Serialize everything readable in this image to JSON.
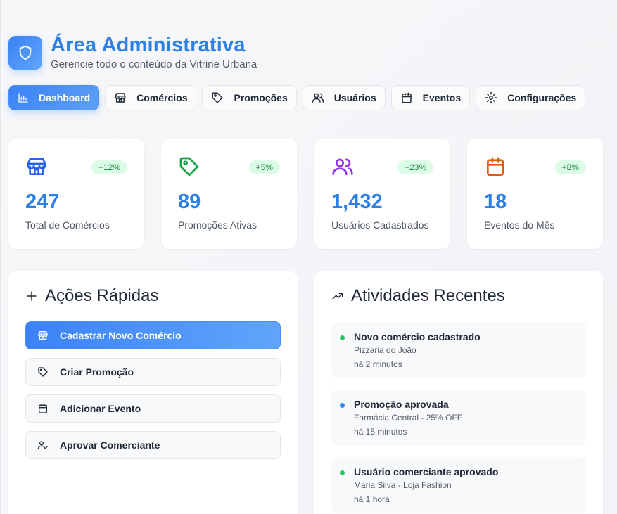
{
  "header": {
    "title": "Área Administrativa",
    "subtitle": "Gerencie todo o conteúdo da Vitrine Urbana",
    "logo_icon": "shield-icon"
  },
  "tabs": [
    {
      "label": "Dashboard",
      "icon": "bar-chart-icon",
      "active": true
    },
    {
      "label": "Comércios",
      "icon": "store-icon",
      "active": false
    },
    {
      "label": "Promoções",
      "icon": "tag-icon",
      "active": false
    },
    {
      "label": "Usuários",
      "icon": "users-icon",
      "active": false
    },
    {
      "label": "Eventos",
      "icon": "calendar-icon",
      "active": false
    },
    {
      "label": "Configurações",
      "icon": "gear-icon",
      "active": false
    }
  ],
  "stats": [
    {
      "value": "247",
      "label": "Total de Comércios",
      "change": "+12%",
      "icon": "store-icon",
      "color": "#2563eb"
    },
    {
      "value": "89",
      "label": "Promoções Ativas",
      "change": "+5%",
      "icon": "tag-icon",
      "color": "#16a34a"
    },
    {
      "value": "1,432",
      "label": "Usuários Cadastrados",
      "change": "+23%",
      "icon": "users-icon",
      "color": "#9333ea"
    },
    {
      "value": "18",
      "label": "Eventos do Mês",
      "change": "+8%",
      "icon": "calendar-icon",
      "color": "#ea580c"
    }
  ],
  "quick_actions": {
    "title": "Ações Rápidas",
    "items": [
      {
        "label": "Cadastrar Novo Comércio",
        "icon": "store-icon",
        "primary": true
      },
      {
        "label": "Criar Promoção",
        "icon": "tag-icon",
        "primary": false
      },
      {
        "label": "Adicionar Evento",
        "icon": "calendar-icon",
        "primary": false
      },
      {
        "label": "Aprovar Comerciante",
        "icon": "user-check-icon",
        "primary": false
      }
    ]
  },
  "recent": {
    "title": "Atividades Recentes",
    "items": [
      {
        "title": "Novo comércio cadastrado",
        "desc": "Pizzaria do João",
        "time": "há 2 minutos",
        "color": "#22c55e"
      },
      {
        "title": "Promoção aprovada",
        "desc": "Farmácia Central - 25% OFF",
        "time": "há 15 minutos",
        "color": "#3b82f6"
      },
      {
        "title": "Usuário comerciante aprovado",
        "desc": "Maria Silva - Loja Fashion",
        "time": "há 1 hora",
        "color": "#22c55e"
      }
    ]
  },
  "colors": {
    "accent": "#2f80e4",
    "badge_bg": "#dcfce7",
    "badge_text": "#15803d"
  }
}
